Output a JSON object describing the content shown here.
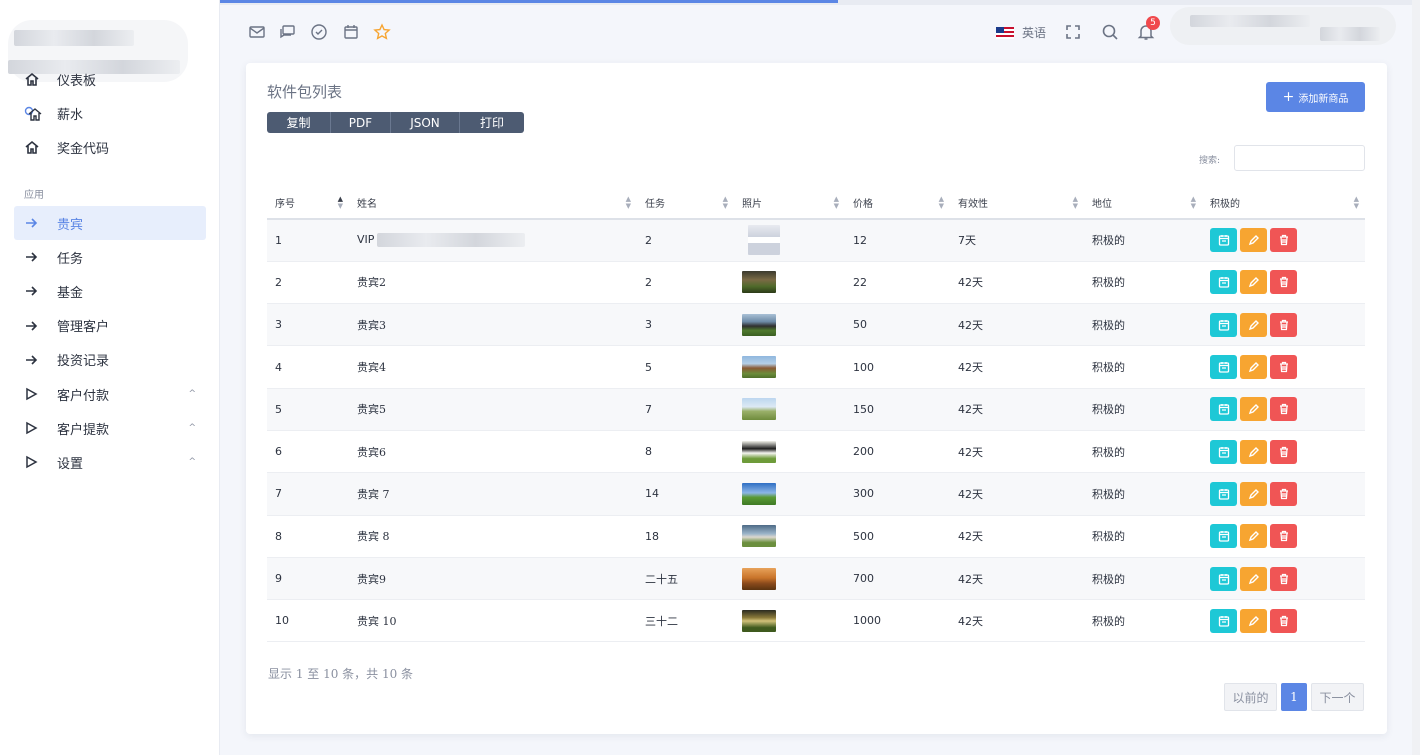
{
  "progress_percent": 59,
  "sidebar": {
    "items_top": [
      {
        "label": "仪表板",
        "icon": "home-icon"
      },
      {
        "label": "薪水",
        "icon": "home-coin-icon"
      },
      {
        "label": "奖金代码",
        "icon": "home-icon"
      }
    ],
    "section_label": "应用",
    "items_app": [
      {
        "label": "贵宾",
        "icon": "arrow-right-icon",
        "active": true
      },
      {
        "label": "任务",
        "icon": "arrow-right-icon"
      },
      {
        "label": "基金",
        "icon": "arrow-right-icon"
      },
      {
        "label": "管理客户",
        "icon": "arrow-right-icon"
      },
      {
        "label": "投资记录",
        "icon": "arrow-right-icon"
      },
      {
        "label": "客户付款",
        "icon": "play-outline-icon",
        "expandable": true
      },
      {
        "label": "客户提款",
        "icon": "play-outline-icon",
        "expandable": true
      },
      {
        "label": "设置",
        "icon": "play-outline-icon",
        "expandable": true
      }
    ]
  },
  "topbar": {
    "icons": [
      "mail-icon",
      "chat-icon",
      "check-circle-icon",
      "calendar-icon",
      "star-icon"
    ],
    "language": "英语",
    "notifications": "5"
  },
  "card": {
    "title": "软件包列表",
    "export_buttons": [
      "复制",
      "PDF",
      "JSON",
      "打印"
    ],
    "add_button": "添加新商品",
    "search_label": "搜索:",
    "search_value": "",
    "columns": [
      "序号",
      "姓名",
      "任务",
      "照片",
      "价格",
      "有效性",
      "地位",
      "积极的"
    ],
    "rows": [
      {
        "no": "1",
        "name": "VIP",
        "task": "2",
        "price": "12",
        "validity": "7天",
        "status": "积极的"
      },
      {
        "no": "2",
        "name": "贵宾2",
        "task": "2",
        "price": "22",
        "validity": "42天",
        "status": "积极的"
      },
      {
        "no": "3",
        "name": "贵宾3",
        "task": "3",
        "price": "50",
        "validity": "42天",
        "status": "积极的"
      },
      {
        "no": "4",
        "name": "贵宾4",
        "task": "5",
        "price": "100",
        "validity": "42天",
        "status": "积极的"
      },
      {
        "no": "5",
        "name": "贵宾5",
        "task": "7",
        "price": "150",
        "validity": "42天",
        "status": "积极的"
      },
      {
        "no": "6",
        "name": "贵宾6",
        "task": "8",
        "price": "200",
        "validity": "42天",
        "status": "积极的"
      },
      {
        "no": "7",
        "name": "贵宾 7",
        "task": "14",
        "price": "300",
        "validity": "42天",
        "status": "积极的"
      },
      {
        "no": "8",
        "name": "贵宾 8",
        "task": "18",
        "price": "500",
        "validity": "42天",
        "status": "积极的"
      },
      {
        "no": "9",
        "name": "贵宾9",
        "task": "二十五",
        "price": "700",
        "validity": "42天",
        "status": "积极的"
      },
      {
        "no": "10",
        "name": "贵宾 10",
        "task": "三十二",
        "price": "1000",
        "validity": "42天",
        "status": "积极的"
      }
    ],
    "info": "显示 1 至 10 条，共 10 条",
    "pager": {
      "prev": "以前的",
      "current": "1",
      "next": "下一个"
    }
  },
  "colors": {
    "accent": "#5b86e5",
    "view": "#1ec8d6",
    "edit": "#f7a531",
    "delete": "#f05555"
  }
}
